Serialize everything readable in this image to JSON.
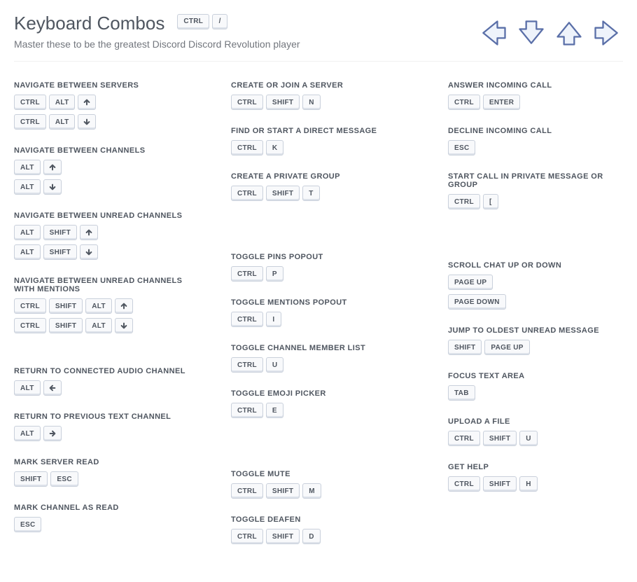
{
  "header": {
    "title": "Keyboard Combos",
    "subtitle": "Master these to be the greatest Discord Discord Revolution player",
    "title_keys": [
      "CTRL",
      "/"
    ]
  },
  "columns": [
    [
      {
        "title": "NAVIGATE BETWEEN SERVERS",
        "rows": [
          [
            "CTRL",
            "ALT",
            "↑"
          ],
          [
            "CTRL",
            "ALT",
            "↓"
          ]
        ]
      },
      {
        "title": "NAVIGATE BETWEEN CHANNELS",
        "rows": [
          [
            "ALT",
            "↑"
          ],
          [
            "ALT",
            "↓"
          ]
        ]
      },
      {
        "title": "NAVIGATE BETWEEN UNREAD CHANNELS",
        "rows": [
          [
            "ALT",
            "SHIFT",
            "↑"
          ],
          [
            "ALT",
            "SHIFT",
            "↓"
          ]
        ]
      },
      {
        "title": "NAVIGATE BETWEEN UNREAD CHANNELS WITH MENTIONS",
        "rows": [
          [
            "CTRL",
            "SHIFT",
            "ALT",
            "↑"
          ],
          [
            "CTRL",
            "SHIFT",
            "ALT",
            "↓"
          ]
        ]
      },
      {
        "spacer": "sm"
      },
      {
        "title": "RETURN TO CONNECTED AUDIO CHANNEL",
        "rows": [
          [
            "ALT",
            "←"
          ]
        ]
      },
      {
        "title": "RETURN TO PREVIOUS TEXT CHANNEL",
        "rows": [
          [
            "ALT",
            "→"
          ]
        ]
      },
      {
        "title": "MARK SERVER READ",
        "rows": [
          [
            "SHIFT",
            "ESC"
          ]
        ]
      },
      {
        "title": "MARK CHANNEL AS READ",
        "rows": [
          [
            "ESC"
          ]
        ]
      }
    ],
    [
      {
        "title": "CREATE OR JOIN A SERVER",
        "rows": [
          [
            "CTRL",
            "SHIFT",
            "N"
          ]
        ]
      },
      {
        "title": "FIND OR START A DIRECT MESSAGE",
        "rows": [
          [
            "CTRL",
            "K"
          ]
        ]
      },
      {
        "title": "CREATE A PRIVATE GROUP",
        "rows": [
          [
            "CTRL",
            "SHIFT",
            "T"
          ]
        ]
      },
      {
        "spacer": "md"
      },
      {
        "title": "TOGGLE PINS POPOUT",
        "rows": [
          [
            "CTRL",
            "P"
          ]
        ]
      },
      {
        "title": "TOGGLE MENTIONS POPOUT",
        "rows": [
          [
            "CTRL",
            "I"
          ]
        ]
      },
      {
        "title": "TOGGLE CHANNEL MEMBER LIST",
        "rows": [
          [
            "CTRL",
            "U"
          ]
        ]
      },
      {
        "title": "TOGGLE EMOJI PICKER",
        "rows": [
          [
            "CTRL",
            "E"
          ]
        ]
      },
      {
        "spacer": "md"
      },
      {
        "title": "TOGGLE MUTE",
        "rows": [
          [
            "CTRL",
            "SHIFT",
            "M"
          ]
        ]
      },
      {
        "title": "TOGGLE DEAFEN",
        "rows": [
          [
            "CTRL",
            "SHIFT",
            "D"
          ]
        ]
      }
    ],
    [
      {
        "title": "ANSWER INCOMING CALL",
        "rows": [
          [
            "CTRL",
            "ENTER"
          ]
        ]
      },
      {
        "title": "DECLINE INCOMING CALL",
        "rows": [
          [
            "ESC"
          ]
        ]
      },
      {
        "title": "START CALL IN PRIVATE MESSAGE OR GROUP",
        "rows": [
          [
            "CTRL",
            "["
          ]
        ]
      },
      {
        "spacer": "md"
      },
      {
        "title": "SCROLL CHAT UP OR DOWN",
        "rows": [
          [
            "PAGE UP"
          ],
          [
            "PAGE DOWN"
          ]
        ]
      },
      {
        "title": "JUMP TO OLDEST UNREAD MESSAGE",
        "rows": [
          [
            "SHIFT",
            "PAGE UP"
          ]
        ]
      },
      {
        "title": "FOCUS TEXT AREA",
        "rows": [
          [
            "TAB"
          ]
        ]
      },
      {
        "title": "UPLOAD A FILE",
        "rows": [
          [
            "CTRL",
            "SHIFT",
            "U"
          ]
        ]
      },
      {
        "title": "GET HELP",
        "rows": [
          [
            "CTRL",
            "SHIFT",
            "H"
          ]
        ]
      }
    ]
  ]
}
